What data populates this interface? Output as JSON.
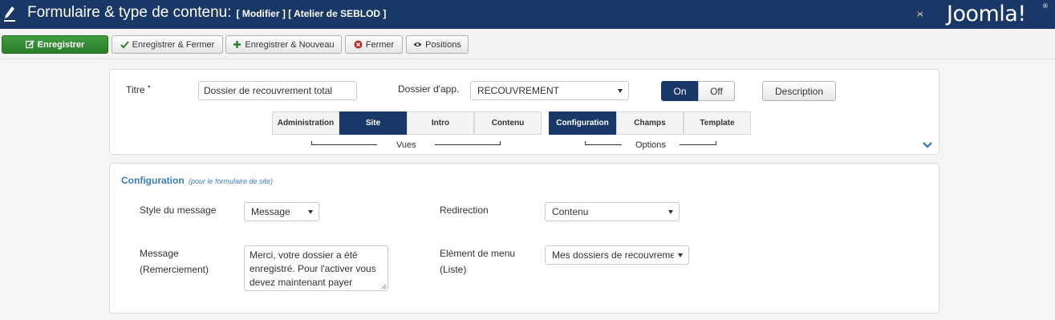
{
  "header": {
    "title": "Formulaire & type de contenu:",
    "subtitle": "[ Modifier ] [ Atelier de SEBLOD ]",
    "logo_text": "Joomla!",
    "logo_reg": "®",
    "bar_color": "#1a3867"
  },
  "toolbar": {
    "save_label": "Enregistrer",
    "save_close_label": "Enregistrer & Fermer",
    "save_new_label": "Enregistrer & Nouveau",
    "close_label": "Fermer",
    "positions_label": "Positions"
  },
  "form": {
    "title_label": "Titre",
    "required_mark": "*",
    "title_value": "Dossier de recouvrement total",
    "folder_label": "Dossier d'app.",
    "folder_value": "RECOUVREMENT",
    "toggle_on": "On",
    "toggle_off": "Off",
    "toggle_state": "On",
    "description_button": "Description"
  },
  "views_tabs": {
    "items": [
      "Administration",
      "Site",
      "Intro",
      "Contenu"
    ],
    "active": "Site",
    "group_label": "Vues"
  },
  "options_tabs": {
    "items": [
      "Configuration",
      "Champs",
      "Template"
    ],
    "active": "Configuration",
    "group_label": "Options"
  },
  "config": {
    "heading": "Configuration",
    "heading_note": "(pour le formulaire de site)",
    "message_style_label": "Style du message",
    "message_style_value": "Message",
    "redirection_label": "Redirection",
    "redirection_value": "Contenu",
    "message_label_line1": "Message",
    "message_label_line2": "(Remerciement)",
    "message_value": "Merci, votre dossier a été enregistré. Pour l'activer vous devez maintenant payer",
    "menu_item_label_line1": "Elément de menu",
    "menu_item_label_line2": "(Liste)",
    "menu_item_value": "Mes dossiers de recouvrement"
  },
  "colors": {
    "primary": "#1a3867",
    "save_green": "#2f8a2f",
    "accent_link": "#3a7dbf"
  }
}
